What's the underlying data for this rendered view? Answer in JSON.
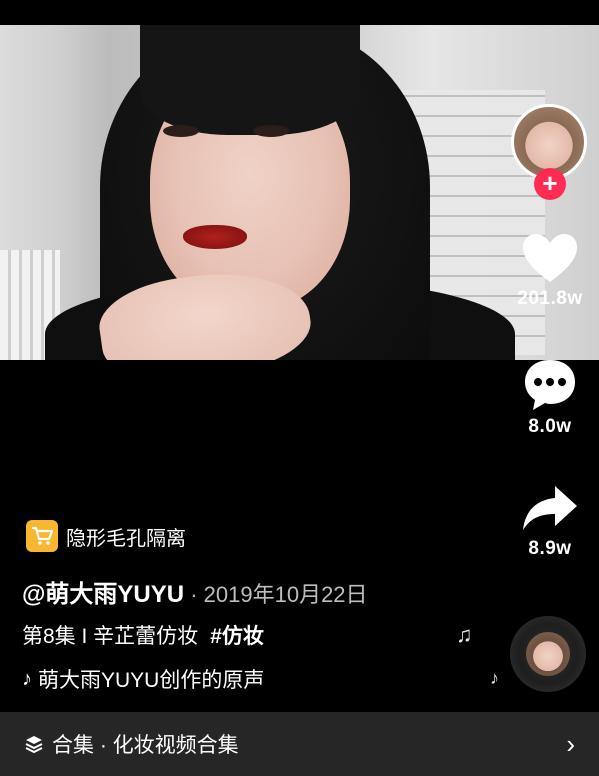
{
  "actions": {
    "like_count": "201.8w",
    "comment_count": "8.0w",
    "share_count": "8.9w",
    "follow_symbol": "+"
  },
  "product": {
    "label": "隐形毛孔隔离"
  },
  "post": {
    "author": "@萌大雨YUYU",
    "separator": " · ",
    "date": "2019年10月22日",
    "description": "第8集 I 辛芷蕾仿妆",
    "hashtag": "#仿妆"
  },
  "music": {
    "text": "萌大雨YUYU创作的原声"
  },
  "collection": {
    "text": "合集 · 化妆视频合集"
  },
  "icons": {
    "like": "heart-icon",
    "comment": "comment-icon",
    "share": "share-icon",
    "cart": "cart-icon",
    "music": "tiktok-icon",
    "collection": "layers-icon",
    "chevron": "chevron-right-icon"
  },
  "colors": {
    "background": "#000000",
    "follow": "#fe2c55",
    "cart_badge": "#f7b731",
    "collection_bar": "#262626"
  }
}
